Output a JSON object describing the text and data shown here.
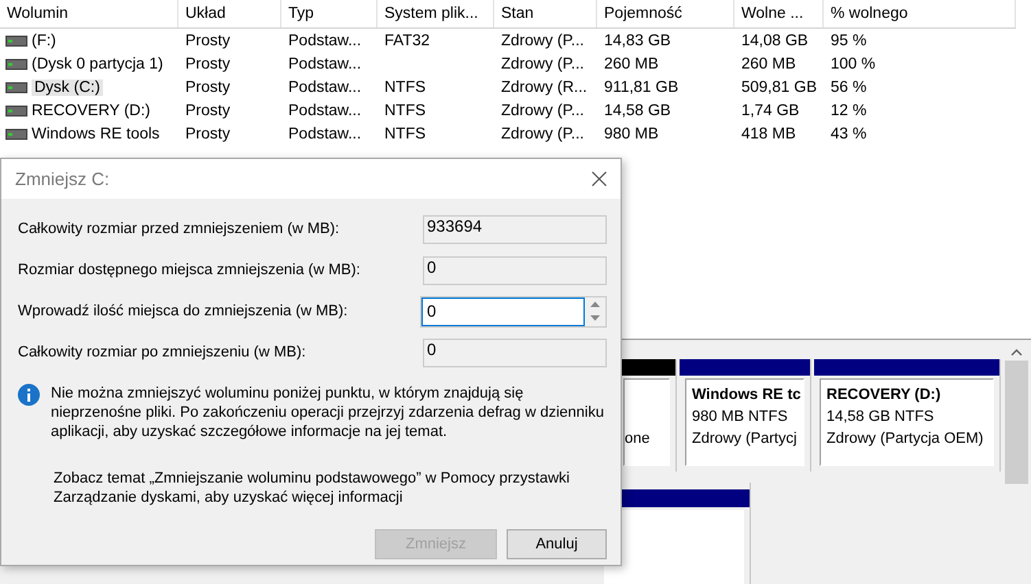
{
  "volumes": {
    "columns": [
      "Wolumin",
      "Układ",
      "Typ",
      "System plik...",
      "Stan",
      "Pojemność",
      "Wolne ...",
      "% wolnego"
    ],
    "rows": [
      {
        "cells": [
          " (F:)",
          "Prosty",
          "Podstaw...",
          "FAT32",
          "Zdrowy (P...",
          "14,83 GB",
          "14,08 GB",
          "95 %"
        ],
        "selected": false
      },
      {
        "cells": [
          "(Dysk 0 partycja 1)",
          "Prosty",
          "Podstaw...",
          "",
          "Zdrowy (P...",
          "260 MB",
          "260 MB",
          "100 %"
        ],
        "selected": false
      },
      {
        "cells": [
          "Dysk (C:)",
          "Prosty",
          "Podstaw...",
          "NTFS",
          "Zdrowy (R...",
          "911,81 GB",
          "509,81 GB",
          "56 %"
        ],
        "selected": true
      },
      {
        "cells": [
          "RECOVERY (D:)",
          "Prosty",
          "Podstaw...",
          "NTFS",
          "Zdrowy (P...",
          "14,58 GB",
          "1,74 GB",
          "12 %"
        ],
        "selected": false
      },
      {
        "cells": [
          "Windows RE tools",
          "Prosty",
          "Podstaw...",
          "NTFS",
          "Zdrowy (P...",
          "980 MB",
          "418 MB",
          "43 %"
        ],
        "selected": false
      }
    ]
  },
  "disk_map": {
    "partitions": [
      {
        "color": "#000000",
        "lines": [
          "one"
        ]
      },
      {
        "color": "#000080",
        "title": "Windows RE tc",
        "lines": [
          "980 MB NTFS",
          "Zdrowy (Partycj"
        ]
      },
      {
        "color": "#000080",
        "title": "RECOVERY  (D:)",
        "lines": [
          "14,58 GB NTFS",
          "Zdrowy (Partycja OEM)"
        ]
      }
    ],
    "second_disk": {
      "color": "#000080"
    }
  },
  "dialog": {
    "title": "Zmniejsz C:",
    "fields": [
      {
        "kind": "readonly",
        "label": "Całkowity rozmiar przed zmniejszeniem (w MB):",
        "value": "933694"
      },
      {
        "kind": "readonly",
        "label": "Rozmiar dostępnego miejsca zmniejszenia (w MB):",
        "value": "0"
      },
      {
        "kind": "spin",
        "label": "Wprowadź ilość miejsca do zmniejszenia (w MB):",
        "value": "0"
      },
      {
        "kind": "readonly",
        "label": "Całkowity rozmiar po zmniejszeniu (w MB):",
        "value": "0"
      }
    ],
    "info": "Nie można zmniejszyć woluminu poniżej punktu, w którym znajdują się nieprzenośne pliki. Po zakończeniu operacji przejrzyj zdarzenia defrag w dzienniku aplikacji, aby uzyskać szczegółowe informacje na jej temat.",
    "help": "Zobacz temat „Zmniejszanie woluminu podstawowego” w Pomocy przystawki Zarządzanie dyskami, aby uzyskać więcej informacji",
    "buttons": [
      {
        "label": "Zmniejsz",
        "disabled": true
      },
      {
        "label": "Anuluj",
        "disabled": false
      }
    ]
  }
}
